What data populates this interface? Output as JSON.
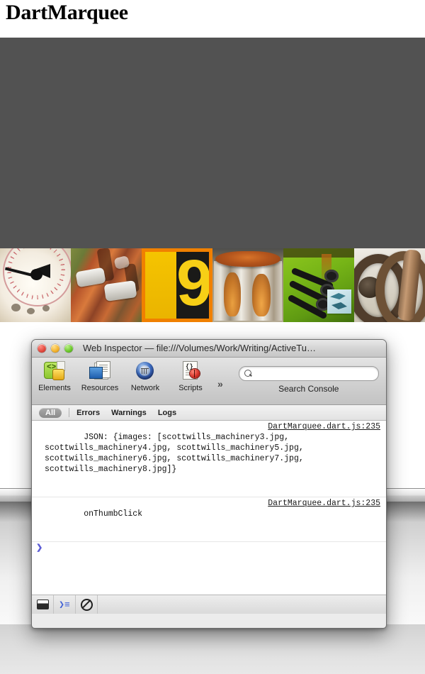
{
  "page": {
    "title": "DartMarquee",
    "stage": {
      "background_color": "#525252"
    },
    "thumbnails": [
      {
        "name": "scottwills_machinery3.jpg",
        "caption": "pressure gauge",
        "selected": false
      },
      {
        "name": "scottwills_machinery4.jpg",
        "caption": "rusty pipe clamps",
        "selected": false
      },
      {
        "name": "scottwills_machinery5.jpg",
        "caption": "yellow number nine sign",
        "selected": true,
        "glyph": "9"
      },
      {
        "name": "scottwills_machinery6.jpg",
        "caption": "rusted cylinder",
        "selected": false
      },
      {
        "name": "scottwills_machinery7.jpg",
        "caption": "green machine with hoses",
        "selected": false
      },
      {
        "name": "scottwills_machinery8.jpg",
        "caption": "rusted chain links",
        "selected": false
      }
    ]
  },
  "inspector": {
    "window_title": "Web Inspector — file:///Volumes/Work/Writing/ActiveTuts/Dart…",
    "traffic_lights": {
      "close": "close",
      "minimize": "minimize",
      "zoom": "zoom"
    },
    "toolbar": {
      "items": [
        {
          "label": "Elements",
          "icon": "elements-icon"
        },
        {
          "label": "Resources",
          "icon": "resources-icon"
        },
        {
          "label": "Network",
          "icon": "network-icon"
        },
        {
          "label": "Scripts",
          "icon": "scripts-icon"
        }
      ],
      "overflow": "»",
      "search": {
        "value": "",
        "placeholder": "",
        "caption": "Search Console",
        "icon": "search-icon"
      }
    },
    "filters": {
      "selected": "All",
      "items": [
        "Errors",
        "Warnings",
        "Logs"
      ]
    },
    "console": {
      "messages": [
        {
          "text": "JSON: {images: [scottwills_machinery3.jpg, scottwills_machinery4.jpg, scottwills_machinery5.jpg, scottwills_machinery6.jpg, scottwills_machinery7.jpg, scottwills_machinery8.jpg]}",
          "source": "DartMarquee.dart.js:235"
        },
        {
          "text": "onThumbClick",
          "source": "DartMarquee.dart.js:235"
        }
      ],
      "prompt": ""
    },
    "bottombar": {
      "buttons": [
        {
          "icon": "dock-console-icon",
          "label": ""
        },
        {
          "icon": "console-prompt-icon",
          "label": "❯≡"
        },
        {
          "icon": "clear-console-icon",
          "label": ""
        }
      ]
    }
  }
}
